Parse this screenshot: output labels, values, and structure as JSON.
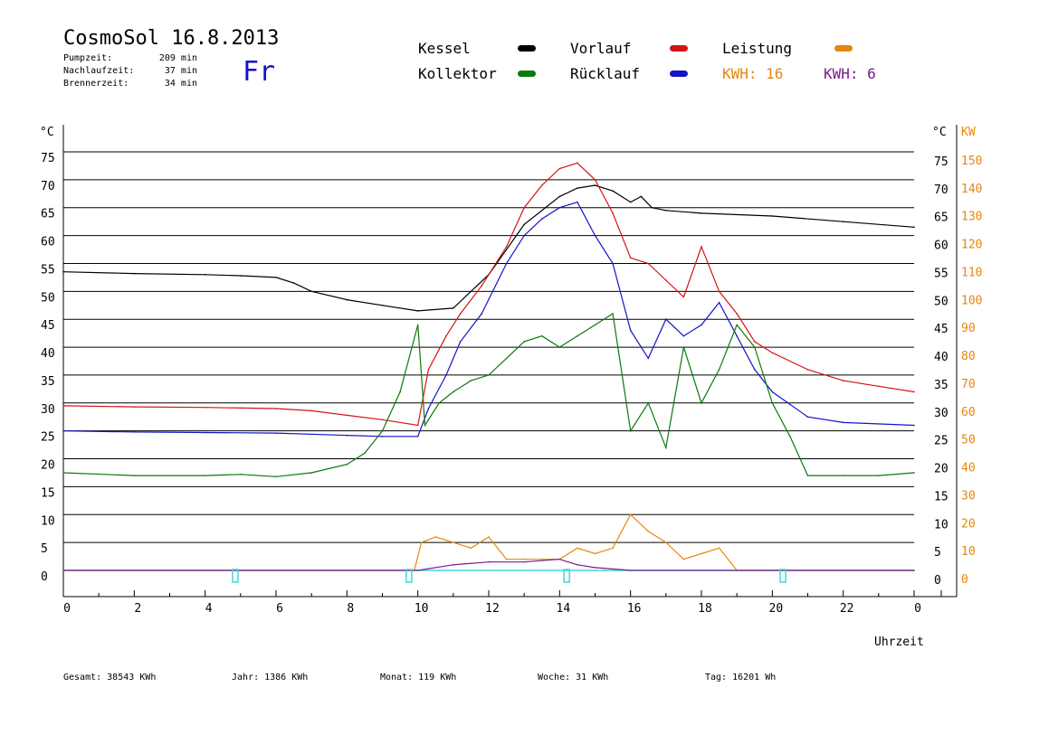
{
  "header": {
    "title": "CosmoSol 16.8.2013",
    "weekday": "Fr",
    "stats": [
      {
        "label": "Pumpzeit:",
        "value": "209 min"
      },
      {
        "label": "Nachlaufzeit:",
        "value": "37 min"
      },
      {
        "label": "Brennerzeit:",
        "value": "34 min"
      }
    ]
  },
  "legend": {
    "kessel": {
      "label": "Kessel",
      "color": "#000000"
    },
    "kollektor": {
      "label": "Kollektor",
      "color": "#0a7a0a"
    },
    "vorlauf": {
      "label": "Vorlauf",
      "color": "#d41414"
    },
    "ruecklauf": {
      "label": "Rücklauf",
      "color": "#1414c8"
    },
    "leistung": {
      "label": "Leistung",
      "color": "#e8860a"
    },
    "kwh1": {
      "label": "KWH: 16",
      "color": "#e8860a"
    },
    "kwh2": {
      "label": "KWH: 6",
      "color": "#7a1a8c"
    }
  },
  "footer": {
    "gesamt": "Gesamt:  38543 KWh",
    "jahr": "Jahr:   1386 KWh",
    "monat": "Monat:     119 KWh",
    "woche": "Woche:      31 KWh",
    "tag": "Tag:  16201 Wh"
  },
  "chart_data": {
    "type": "line",
    "xlabel": "Uhrzeit",
    "ylabel_left": "°C",
    "ylabel_right_temp": "°C",
    "ylabel_right_power": "KW",
    "xlim": [
      0,
      24
    ],
    "ylim": [
      0,
      75
    ],
    "y2lim": [
      0,
      150
    ],
    "x_ticks": [
      "0",
      "2",
      "4",
      "6",
      "8",
      "10",
      "12",
      "14",
      "16",
      "18",
      "20",
      "22",
      "0"
    ],
    "y_ticks": [
      0,
      5,
      10,
      15,
      20,
      25,
      30,
      35,
      40,
      45,
      50,
      55,
      60,
      65,
      70,
      75
    ],
    "y2_ticks": [
      0,
      10,
      20,
      30,
      40,
      50,
      60,
      70,
      80,
      90,
      100,
      110,
      120,
      130,
      140,
      150
    ],
    "grid": true,
    "series": [
      {
        "name": "Kessel",
        "color": "#000000",
        "x": [
          0,
          2,
          4,
          5,
          6,
          6.5,
          7,
          8,
          9,
          10,
          11,
          12,
          13,
          14,
          14.5,
          15,
          15.5,
          16,
          16.3,
          16.6,
          17,
          18,
          20,
          22,
          24
        ],
        "y": [
          53.5,
          53.2,
          53,
          52.8,
          52.5,
          51.5,
          50,
          48.5,
          47.5,
          46.5,
          47,
          53,
          62,
          67,
          68.5,
          69,
          68,
          66,
          67,
          65,
          64.5,
          64,
          63.5,
          62.5,
          61.5
        ]
      },
      {
        "name": "Vorlauf",
        "color": "#d41414",
        "x": [
          0,
          2,
          4,
          6,
          7,
          8,
          9,
          10,
          10.3,
          10.8,
          11.2,
          11.8,
          12.5,
          13,
          13.5,
          14,
          14.5,
          15,
          15.5,
          16,
          16.5,
          17,
          17.5,
          18,
          18.5,
          19,
          19.5,
          20,
          21,
          22,
          23,
          24
        ],
        "y": [
          29.5,
          29.3,
          29.2,
          29,
          28.6,
          27.8,
          27,
          26,
          36,
          42,
          46,
          51,
          58,
          65,
          69,
          72,
          73,
          70,
          64,
          56,
          55,
          52,
          49,
          58,
          50,
          46,
          41,
          39,
          36,
          34,
          33,
          32
        ]
      },
      {
        "name": "Rücklauf",
        "color": "#1414c8",
        "x": [
          0,
          2,
          4,
          6,
          8,
          9,
          10,
          10.3,
          10.8,
          11.2,
          11.8,
          12.5,
          13,
          13.5,
          14,
          14.5,
          15,
          15.5,
          16,
          16.5,
          17,
          17.5,
          18,
          18.5,
          19,
          19.5,
          20,
          21,
          22,
          24
        ],
        "y": [
          25,
          24.8,
          24.7,
          24.6,
          24.2,
          24,
          24,
          29,
          35,
          41,
          46,
          55,
          60,
          63,
          65,
          66,
          60,
          55,
          43,
          38,
          45,
          42,
          44,
          48,
          42,
          36,
          32,
          27.5,
          26.5,
          26
        ]
      },
      {
        "name": "Kollektor",
        "color": "#0a7a0a",
        "x": [
          0,
          2,
          4,
          5,
          6,
          7,
          8,
          8.5,
          9,
          9.5,
          10,
          10.2,
          10.6,
          11,
          11.5,
          12,
          12.5,
          13,
          13.5,
          14,
          14.5,
          15,
          15.5,
          16,
          16.5,
          17,
          17.5,
          18,
          18.5,
          19,
          19.5,
          20,
          20.5,
          21,
          22,
          23,
          24
        ],
        "y": [
          17.5,
          17,
          17,
          17.2,
          16.8,
          17.5,
          19,
          21,
          25,
          32,
          44,
          26,
          30,
          32,
          34,
          35,
          38,
          41,
          42,
          40,
          42,
          44,
          46,
          25,
          30,
          22,
          40,
          30,
          36,
          44,
          40,
          30,
          24,
          17,
          17,
          17,
          17.5
        ]
      },
      {
        "name": "Leistung",
        "color": "#e8860a",
        "x": [
          0,
          9.9,
          10.1,
          10.5,
          11,
          11.5,
          12,
          12.5,
          13,
          13.5,
          14,
          14.5,
          15,
          15.5,
          16,
          16.5,
          17,
          17.5,
          18,
          18.5,
          19,
          24
        ],
        "y2": [
          0,
          0,
          10,
          12,
          10,
          8,
          12,
          4,
          4,
          4,
          4,
          8,
          6,
          8,
          20,
          14,
          10,
          4,
          6,
          8,
          0,
          0
        ]
      },
      {
        "name": "KWH",
        "color": "#7a1a8c",
        "x": [
          0,
          10,
          11,
          12,
          13,
          14,
          14.5,
          15,
          16,
          24
        ],
        "y2": [
          0,
          0,
          2,
          3,
          3,
          4,
          2,
          1,
          0,
          0
        ]
      }
    ],
    "pump_markers_x": [
      4.85,
      9.75,
      14.2,
      20.3
    ]
  }
}
